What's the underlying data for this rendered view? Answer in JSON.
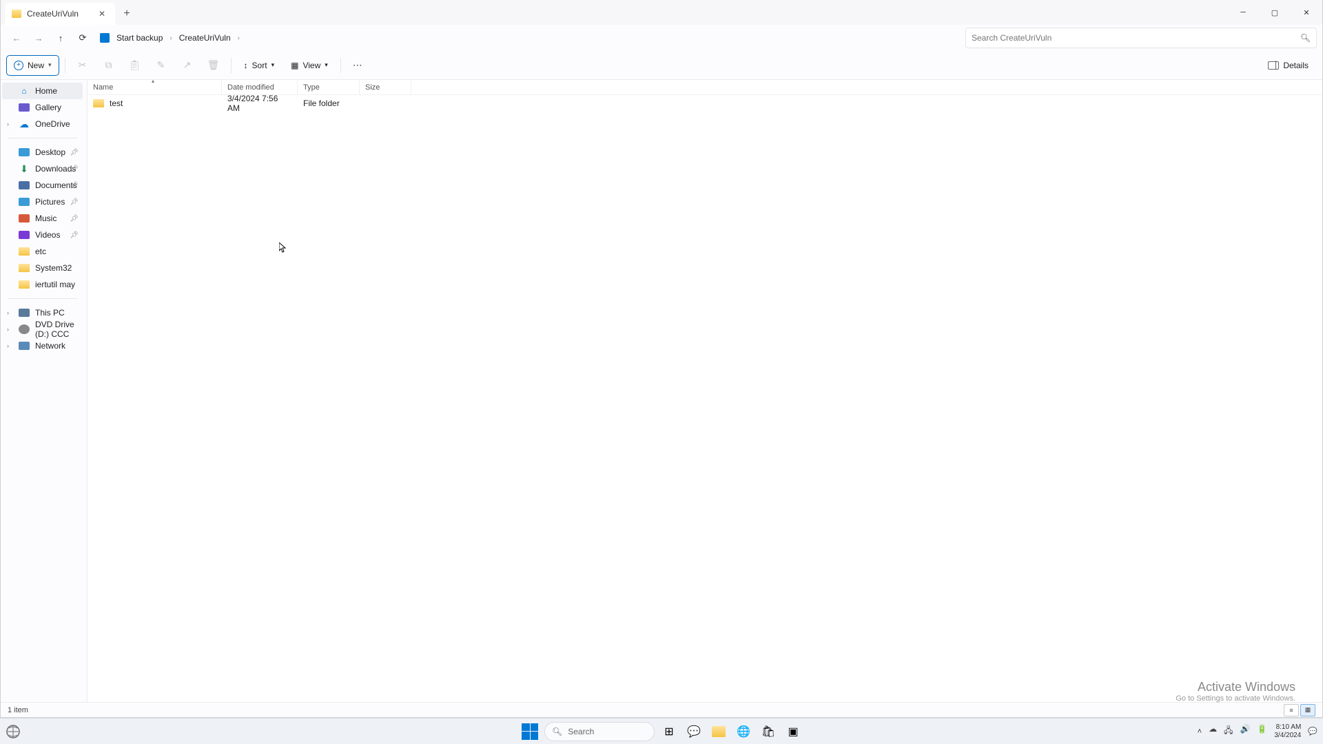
{
  "tab": {
    "title": "CreateUriVuln"
  },
  "breadcrumb": {
    "root": "Start backup",
    "current": "CreateUriVuln"
  },
  "search": {
    "placeholder": "Search CreateUriVuln"
  },
  "toolbar": {
    "new": "New",
    "sort": "Sort",
    "view": "View",
    "details": "Details"
  },
  "columns": {
    "name": "Name",
    "date": "Date modified",
    "type": "Type",
    "size": "Size"
  },
  "rows": [
    {
      "name": "test",
      "date": "3/4/2024 7:56 AM",
      "type": "File folder",
      "size": ""
    }
  ],
  "sidebar_top": [
    {
      "label": "Home",
      "icon": "home",
      "selected": true
    },
    {
      "label": "Gallery",
      "icon": "gal"
    },
    {
      "label": "OneDrive",
      "icon": "cloud",
      "expand": true
    }
  ],
  "sidebar_quick": [
    {
      "label": "Desktop",
      "icon": "desk",
      "pin": true
    },
    {
      "label": "Downloads",
      "icon": "dl",
      "pin": true
    },
    {
      "label": "Documents",
      "icon": "doc",
      "pin": true
    },
    {
      "label": "Pictures",
      "icon": "pic",
      "pin": true
    },
    {
      "label": "Music",
      "icon": "mus",
      "pin": true
    },
    {
      "label": "Videos",
      "icon": "vid",
      "pin": true
    },
    {
      "label": "etc",
      "icon": "folder"
    },
    {
      "label": "System32",
      "icon": "folder"
    },
    {
      "label": "iertutil may",
      "icon": "folder"
    }
  ],
  "sidebar_drives": [
    {
      "label": "This PC",
      "icon": "pc",
      "expand": true
    },
    {
      "label": "DVD Drive (D:) CCC",
      "icon": "disc",
      "expand": true
    },
    {
      "label": "Network",
      "icon": "net",
      "expand": true
    }
  ],
  "status": {
    "count": "1 item"
  },
  "watermark": {
    "title": "Activate Windows",
    "sub": "Go to Settings to activate Windows."
  },
  "taskbar": {
    "search": "Search",
    "time": "8:10 AM",
    "date": "3/4/2024"
  }
}
